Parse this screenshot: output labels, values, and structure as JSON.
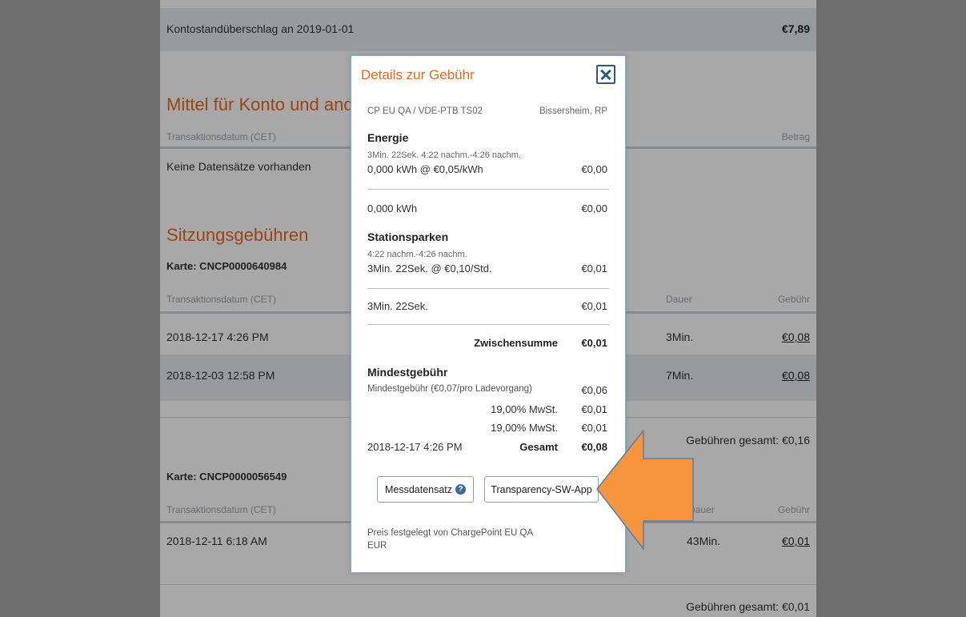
{
  "balance": {
    "label": "Kontostandüberschlag an 2019-01-01",
    "amount": "€7,89"
  },
  "funds": {
    "title": "Mittel für Konto und and",
    "col_date": "Transaktionsdatum (CET)",
    "col_amount": "Betrag",
    "empty": "Keine Datensätze vorhanden"
  },
  "sessions": {
    "title": "Sitzungsgebühren",
    "col_date": "Transaktionsdatum (CET)",
    "col_duration": "Dauer",
    "col_fee": "Gebühr",
    "card1": {
      "label": "Karte: CNCP0000640984",
      "rows": [
        {
          "date": "2018-12-17 4:26 PM",
          "duration": "3Min.",
          "fee": "€0,08"
        },
        {
          "date": "2018-12-03 12:58 PM",
          "duration": "7Min.",
          "fee": "€0,08"
        }
      ],
      "total": "Gebühren gesamt: €0,16"
    },
    "card2": {
      "label": "Karte: CNCP0000056549",
      "rows": [
        {
          "date": "2018-12-11 6:18 AM",
          "duration": "43Min.",
          "fee": "€0,01"
        }
      ],
      "total": "Gebühren gesamt: €0,01"
    }
  },
  "modal": {
    "title": "Details zur Gebühr",
    "station": "CP EU QA / VDE-PTB TS02",
    "location": "Bissersheim, RP",
    "energy": {
      "heading": "Energie",
      "time": "3Min. 22Sek. 4:22 nachm.-4:26 nachm.",
      "line": "0,000 kWh @ €0,05/kWh",
      "line_amount": "€0,00",
      "total": "0,000 kWh",
      "total_amount": "€0,00"
    },
    "parking": {
      "heading": "Stationsparken",
      "time": "4:22 nachm.-4:26 nachm.",
      "line": "3Min. 22Sek. @ €0,10/Std.",
      "line_amount": "€0,01",
      "total": "3Min. 22Sek.",
      "total_amount": "€0,01"
    },
    "subtotal_label": "Zwischensumme",
    "subtotal_amount": "€0,01",
    "minimum": {
      "heading": "Mindestgebühr",
      "line": "Mindestgebühr (€0,07/pro Ladevorgang)",
      "line_amount": "€0,06"
    },
    "vat1_label": "19,00% MwSt.",
    "vat1_amount": "€0,01",
    "vat2_label": "19,00% MwSt.",
    "vat2_amount": "€0,01",
    "date": "2018-12-17 4:26 PM",
    "grand_label": "Gesamt",
    "grand_amount": "€0,08",
    "btn_meter": "Messdatensatz",
    "btn_app": "Transparency-SW-App",
    "price_by": "Preis festgelegt von ChargePoint EU QA",
    "currency": "EUR"
  },
  "colors": {
    "accent": "#e8691f",
    "arrow": "#f7943e",
    "link_border": "#7eb0d2"
  },
  "icons": {
    "close": "close-icon",
    "help": "question-circle-icon",
    "arrow": "arrow-left-icon"
  }
}
